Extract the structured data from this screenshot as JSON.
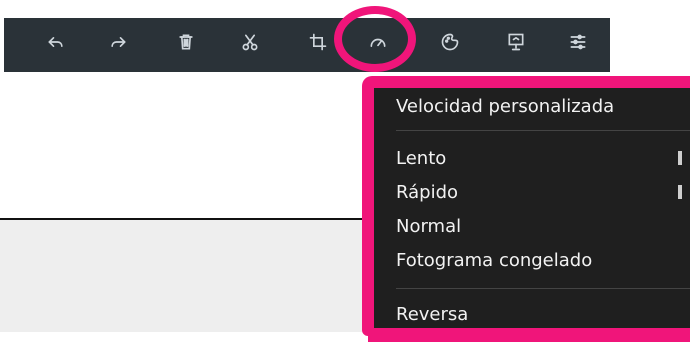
{
  "toolbar": {
    "buttons": [
      {
        "name": "undo-icon"
      },
      {
        "name": "redo-icon"
      },
      {
        "name": "delete-icon"
      },
      {
        "name": "cut-icon"
      },
      {
        "name": "crop-icon"
      },
      {
        "name": "speed-icon"
      },
      {
        "name": "color-filter-icon"
      },
      {
        "name": "presentation-icon"
      },
      {
        "name": "settings-sliders-icon"
      }
    ]
  },
  "speed_menu": {
    "custom": "Velocidad personalizada",
    "slow": "Lento",
    "fast": "Rápido",
    "normal": "Normal",
    "freeze": "Fotograma congelado",
    "reverse": "Reversa"
  },
  "colors": {
    "toolbar_bg": "#2a3238",
    "menu_bg": "#1f1f1f",
    "highlight": "#f0157a"
  }
}
